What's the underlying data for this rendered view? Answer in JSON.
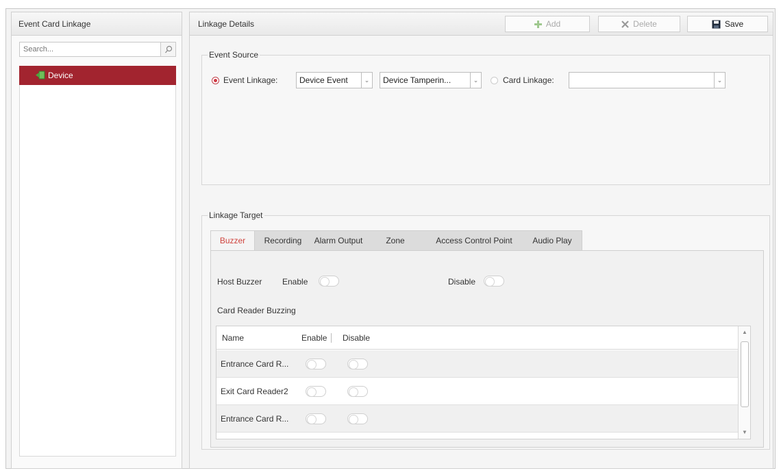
{
  "left_panel": {
    "title": "Event Card Linkage",
    "search_placeholder": "Search...",
    "tree": [
      {
        "label": "Device",
        "selected": true
      }
    ]
  },
  "right_panel": {
    "title": "Linkage Details",
    "toolbar": {
      "add_label": "Add",
      "delete_label": "Delete",
      "save_label": "Save"
    },
    "event_source": {
      "title": "Event Source",
      "event_linkage_label": "Event Linkage:",
      "event_linkage_checked": true,
      "event_type_value": "Device Event",
      "event_value": "Device Tamperin...",
      "card_linkage_label": "Card Linkage:",
      "card_linkage_value": ""
    },
    "linkage_target": {
      "title": "Linkage Target",
      "tabs": [
        "Buzzer",
        "Recording",
        "Alarm Output",
        "Zone",
        "Access Control Point",
        "Audio Play"
      ],
      "active_tab": "Buzzer",
      "host_buzzer_label": "Host Buzzer",
      "enable_label": "Enable",
      "disable_label": "Disable",
      "card_reader_buzzing_label": "Card Reader Buzzing",
      "table": {
        "columns": [
          "Name",
          "Enable",
          "Disable"
        ],
        "rows": [
          {
            "name": "Entrance Card R...",
            "enable": false,
            "disable": false
          },
          {
            "name": "Exit Card Reader2",
            "enable": false,
            "disable": false
          },
          {
            "name": "Entrance Card R...",
            "enable": false,
            "disable": false
          }
        ]
      }
    }
  },
  "colors": {
    "accent": "#a2242f",
    "active_tab_text": "#d0443e"
  }
}
